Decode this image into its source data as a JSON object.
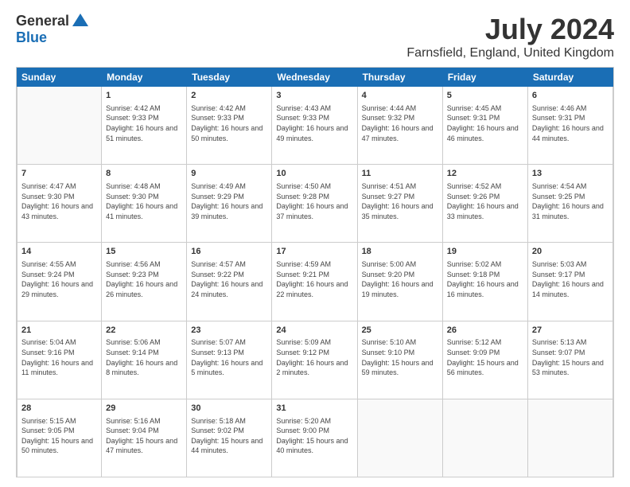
{
  "logo": {
    "general": "General",
    "blue": "Blue"
  },
  "header": {
    "title": "July 2024",
    "subtitle": "Farnsfield, England, United Kingdom"
  },
  "weekdays": [
    "Sunday",
    "Monday",
    "Tuesday",
    "Wednesday",
    "Thursday",
    "Friday",
    "Saturday"
  ],
  "weeks": [
    [
      {
        "day": "",
        "info": ""
      },
      {
        "day": "1",
        "info": "Sunrise: 4:42 AM\nSunset: 9:33 PM\nDaylight: 16 hours\nand 51 minutes."
      },
      {
        "day": "2",
        "info": "Sunrise: 4:42 AM\nSunset: 9:33 PM\nDaylight: 16 hours\nand 50 minutes."
      },
      {
        "day": "3",
        "info": "Sunrise: 4:43 AM\nSunset: 9:33 PM\nDaylight: 16 hours\nand 49 minutes."
      },
      {
        "day": "4",
        "info": "Sunrise: 4:44 AM\nSunset: 9:32 PM\nDaylight: 16 hours\nand 47 minutes."
      },
      {
        "day": "5",
        "info": "Sunrise: 4:45 AM\nSunset: 9:31 PM\nDaylight: 16 hours\nand 46 minutes."
      },
      {
        "day": "6",
        "info": "Sunrise: 4:46 AM\nSunset: 9:31 PM\nDaylight: 16 hours\nand 44 minutes."
      }
    ],
    [
      {
        "day": "7",
        "info": "Sunrise: 4:47 AM\nSunset: 9:30 PM\nDaylight: 16 hours\nand 43 minutes."
      },
      {
        "day": "8",
        "info": "Sunrise: 4:48 AM\nSunset: 9:30 PM\nDaylight: 16 hours\nand 41 minutes."
      },
      {
        "day": "9",
        "info": "Sunrise: 4:49 AM\nSunset: 9:29 PM\nDaylight: 16 hours\nand 39 minutes."
      },
      {
        "day": "10",
        "info": "Sunrise: 4:50 AM\nSunset: 9:28 PM\nDaylight: 16 hours\nand 37 minutes."
      },
      {
        "day": "11",
        "info": "Sunrise: 4:51 AM\nSunset: 9:27 PM\nDaylight: 16 hours\nand 35 minutes."
      },
      {
        "day": "12",
        "info": "Sunrise: 4:52 AM\nSunset: 9:26 PM\nDaylight: 16 hours\nand 33 minutes."
      },
      {
        "day": "13",
        "info": "Sunrise: 4:54 AM\nSunset: 9:25 PM\nDaylight: 16 hours\nand 31 minutes."
      }
    ],
    [
      {
        "day": "14",
        "info": "Sunrise: 4:55 AM\nSunset: 9:24 PM\nDaylight: 16 hours\nand 29 minutes."
      },
      {
        "day": "15",
        "info": "Sunrise: 4:56 AM\nSunset: 9:23 PM\nDaylight: 16 hours\nand 26 minutes."
      },
      {
        "day": "16",
        "info": "Sunrise: 4:57 AM\nSunset: 9:22 PM\nDaylight: 16 hours\nand 24 minutes."
      },
      {
        "day": "17",
        "info": "Sunrise: 4:59 AM\nSunset: 9:21 PM\nDaylight: 16 hours\nand 22 minutes."
      },
      {
        "day": "18",
        "info": "Sunrise: 5:00 AM\nSunset: 9:20 PM\nDaylight: 16 hours\nand 19 minutes."
      },
      {
        "day": "19",
        "info": "Sunrise: 5:02 AM\nSunset: 9:18 PM\nDaylight: 16 hours\nand 16 minutes."
      },
      {
        "day": "20",
        "info": "Sunrise: 5:03 AM\nSunset: 9:17 PM\nDaylight: 16 hours\nand 14 minutes."
      }
    ],
    [
      {
        "day": "21",
        "info": "Sunrise: 5:04 AM\nSunset: 9:16 PM\nDaylight: 16 hours\nand 11 minutes."
      },
      {
        "day": "22",
        "info": "Sunrise: 5:06 AM\nSunset: 9:14 PM\nDaylight: 16 hours\nand 8 minutes."
      },
      {
        "day": "23",
        "info": "Sunrise: 5:07 AM\nSunset: 9:13 PM\nDaylight: 16 hours\nand 5 minutes."
      },
      {
        "day": "24",
        "info": "Sunrise: 5:09 AM\nSunset: 9:12 PM\nDaylight: 16 hours\nand 2 minutes."
      },
      {
        "day": "25",
        "info": "Sunrise: 5:10 AM\nSunset: 9:10 PM\nDaylight: 15 hours\nand 59 minutes."
      },
      {
        "day": "26",
        "info": "Sunrise: 5:12 AM\nSunset: 9:09 PM\nDaylight: 15 hours\nand 56 minutes."
      },
      {
        "day": "27",
        "info": "Sunrise: 5:13 AM\nSunset: 9:07 PM\nDaylight: 15 hours\nand 53 minutes."
      }
    ],
    [
      {
        "day": "28",
        "info": "Sunrise: 5:15 AM\nSunset: 9:05 PM\nDaylight: 15 hours\nand 50 minutes."
      },
      {
        "day": "29",
        "info": "Sunrise: 5:16 AM\nSunset: 9:04 PM\nDaylight: 15 hours\nand 47 minutes."
      },
      {
        "day": "30",
        "info": "Sunrise: 5:18 AM\nSunset: 9:02 PM\nDaylight: 15 hours\nand 44 minutes."
      },
      {
        "day": "31",
        "info": "Sunrise: 5:20 AM\nSunset: 9:00 PM\nDaylight: 15 hours\nand 40 minutes."
      },
      {
        "day": "",
        "info": ""
      },
      {
        "day": "",
        "info": ""
      },
      {
        "day": "",
        "info": ""
      }
    ]
  ]
}
